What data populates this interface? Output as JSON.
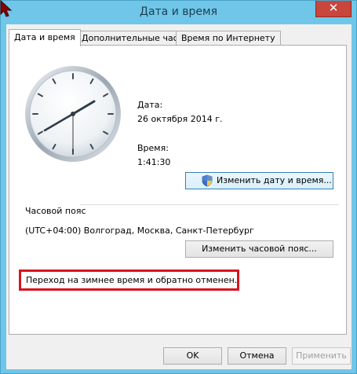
{
  "window": {
    "title": "Дата и время",
    "close_label": "✕"
  },
  "tabs": [
    {
      "label": "Дата и время",
      "active": true
    },
    {
      "label": "Дополнительные часы",
      "active": false
    },
    {
      "label": "Время по Интернету",
      "active": false
    }
  ],
  "datetime": {
    "date_label": "Дата:",
    "date_value": "26 октября 2014 г.",
    "time_label": "Время:",
    "time_value": "1:41:30",
    "change_button": "Изменить дату и время..."
  },
  "timezone": {
    "section_label": "Часовой пояс",
    "value": "(UTC+04:00) Волгоград, Москва, Санкт-Петербург",
    "change_button": "Изменить часовой пояс..."
  },
  "notice": {
    "text": "Переход на зимнее время и обратно отменен."
  },
  "footer": {
    "ok": "OK",
    "cancel": "Отмена",
    "apply": "Применить"
  },
  "colors": {
    "titlebar": "#6fc6e8",
    "close": "#c8463c",
    "notice_border": "#d9141e"
  }
}
